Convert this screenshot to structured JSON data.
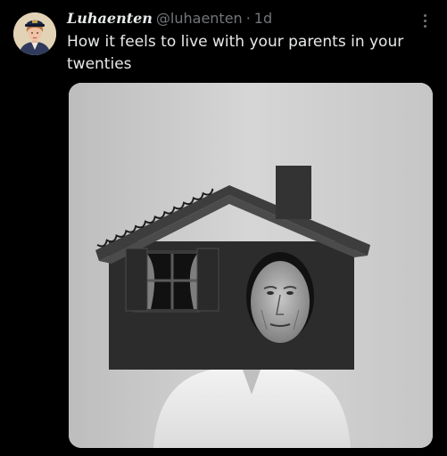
{
  "tweet": {
    "display_name": "Luhaenten",
    "handle": "@luhaenten",
    "separator": "·",
    "time": "1d",
    "text": "How it feels to live with your parents in your twenties"
  },
  "icons": {
    "more": "more-vertical-icon",
    "avatar": "avatar-portrait"
  },
  "colors": {
    "background": "#000000",
    "text": "#e7e9ea",
    "secondary_text": "#71767b"
  }
}
